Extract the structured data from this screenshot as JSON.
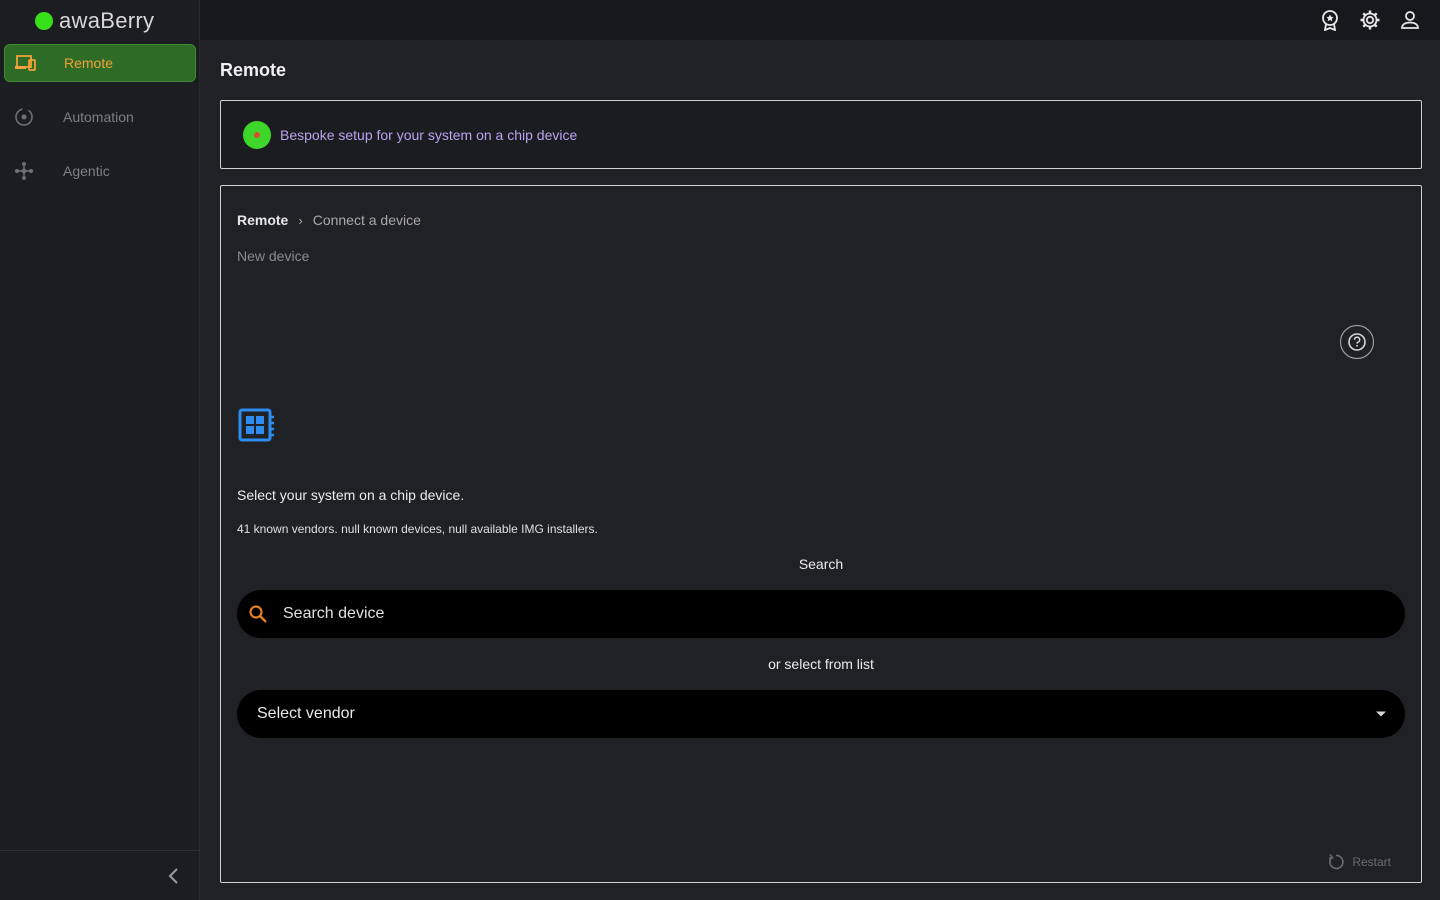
{
  "app": {
    "name": "awaBerry"
  },
  "colors": {
    "accent_green": "#38e01b",
    "active_text": "#f2a23a",
    "banner_text": "#b9a4f2",
    "chip_blue": "#2d8cf0",
    "search_icon": "#e67e22"
  },
  "sidebar": {
    "items": [
      {
        "label": "Remote",
        "icon": "devices-icon",
        "active": true
      },
      {
        "label": "Automation",
        "icon": "automation-icon",
        "active": false
      },
      {
        "label": "Agentic",
        "icon": "agentic-icon",
        "active": false
      }
    ],
    "collapse_icon": "chevron-left-icon"
  },
  "topbar": {
    "icons": [
      "award-icon",
      "gear-icon",
      "user-icon"
    ]
  },
  "page": {
    "title": "Remote"
  },
  "banner": {
    "text": "Bespoke setup for your system on a chip device"
  },
  "breadcrumb": {
    "home": "Remote",
    "current": "Connect a device"
  },
  "card": {
    "subtitle": "New device",
    "select_title": "Select your system on a chip device.",
    "stats": "41 known vendors. null known devices, null available IMG installers.",
    "search_label": "Search",
    "search_placeholder": "Search device",
    "or_label": "or select from list",
    "select_value": "Select vendor",
    "restart_label": "Restart"
  }
}
